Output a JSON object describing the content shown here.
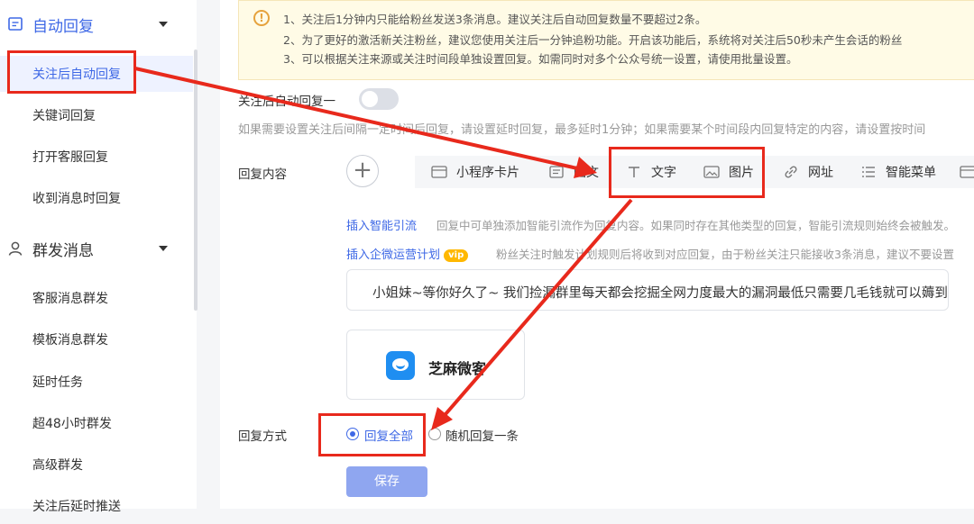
{
  "sidebar": {
    "groups": [
      {
        "label": "自动回复",
        "icon": "message-square-icon"
      },
      {
        "label": "群发消息",
        "icon": "user-icon"
      }
    ],
    "auto_reply_items": [
      "关注后自动回复",
      "关键词回复",
      "打开客服回复",
      "收到消息时回复"
    ],
    "mass_items": [
      "客服消息群发",
      "模板消息群发",
      "延时任务",
      "超48小时群发",
      "高级群发",
      "关注后延时推送"
    ]
  },
  "notice": {
    "icon": "warning-icon",
    "lines": [
      "1、关注后1分钟内只能给粉丝发送3条消息。建议关注后自动回复数量不要超过2条。",
      "2、为了更好的激活新关注粉丝，建议您使用关注后一分钟追粉功能。开启该功能后，系统将对关注后50秒未产生会话的粉丝",
      "3、可以根据关注来源或关注时间段单独设置回复。如需同时对多个公众号统一设置，请使用批量设置。"
    ]
  },
  "rule": {
    "title": "关注后自动回复一",
    "toggle_on": false,
    "hint": "如果需要设置关注后间隔一定时间后回复，请设置延时回复，最多延时1分钟；如果需要某个时间段内回复特定的内容，请设置按时间"
  },
  "reply_content": {
    "label": "回复内容",
    "add_symbol": "+",
    "tools": [
      {
        "label": "小程序卡片",
        "icon": "card-icon"
      },
      {
        "label": "图文",
        "icon": "article-icon"
      },
      {
        "label": "文字",
        "icon": "text-icon"
      },
      {
        "label": "图片",
        "icon": "image-icon"
      },
      {
        "label": "网址",
        "icon": "link-icon"
      },
      {
        "label": "智能菜单",
        "icon": "menu-icon"
      }
    ],
    "smart_link": "插入智能引流",
    "smart_desc": "回复中可单独添加智能引流作为回复内容。如果同时存在其他类型的回复，智能引流规则始终会被触发。",
    "wecom_link": "插入企微运营计划",
    "vip_badge": "vip",
    "wecom_desc": "粉丝关注时触发计划规则后将收到对应回复，由于粉丝关注只能接收3条消息，建议不要设置",
    "message_text": "小姐妹~等你好久了~ 我们捡漏群里每天都会挖掘全网力度最大的漏洞最低只需要几毛钱就可以薅到",
    "card_name": "芝麻微客"
  },
  "reply_mode": {
    "label": "回复方式",
    "options": [
      "回复全部",
      "随机回复一条"
    ],
    "selected": 0
  },
  "save_label": "保存",
  "colors": {
    "accent": "#3e68e6",
    "annotation": "#e8291c",
    "notice_bg": "#fffbe6"
  }
}
